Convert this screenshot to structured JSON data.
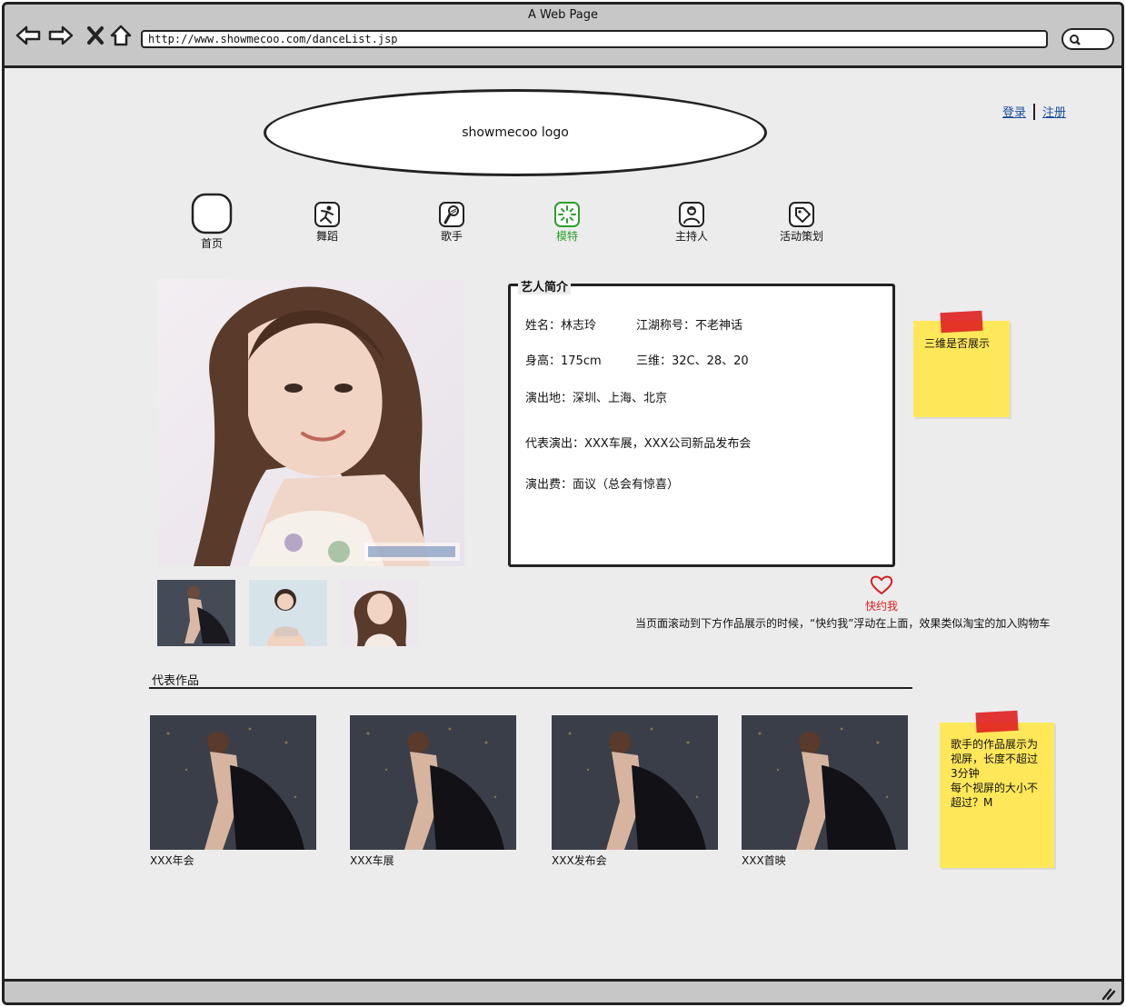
{
  "window": {
    "title": "A Web Page",
    "url": "http://www.showmecoo.com/danceList.jsp"
  },
  "header": {
    "logo_text": "showmecoo logo",
    "login": "登录",
    "register": "注册"
  },
  "nav": [
    {
      "label": "首页",
      "icon": "blank-tile-icon",
      "active": false
    },
    {
      "label": "舞蹈",
      "icon": "dancer-icon",
      "active": false
    },
    {
      "label": "歌手",
      "icon": "microphone-icon",
      "active": false
    },
    {
      "label": "模特",
      "icon": "loading-spinner-icon",
      "active": true
    },
    {
      "label": "主持人",
      "icon": "host-person-icon",
      "active": false
    },
    {
      "label": "活动策划",
      "icon": "tag-icon",
      "active": false
    }
  ],
  "profile": {
    "title": "艺人简介",
    "name": "姓名：林志玲",
    "nickname": "江湖称号：不老神话",
    "height": "身高：175cm",
    "measurements": "三维：32C、28、20",
    "locations": "演出地：深圳、上海、北京",
    "shows": "代表演出：XXX车展，XXX公司新品发布会",
    "fee": "演出费：面议（总会有惊喜）"
  },
  "notes": {
    "note1": "三维是否展示",
    "note2_lines": [
      "歌手的作品展示为",
      "视屏，长度不超过",
      "3分钟",
      "每个视屏的大小不",
      "超过？M"
    ]
  },
  "quick_book": {
    "label": "快约我",
    "description": "当页面滚动到下方作品展示的时候，“快约我”浮动在上面，效果类似淘宝的加入购物车"
  },
  "works": {
    "title": "代表作品",
    "items": [
      {
        "caption": "XXX年会"
      },
      {
        "caption": "XXX车展"
      },
      {
        "caption": "XXX发布会"
      },
      {
        "caption": "XXX首映"
      }
    ]
  },
  "colors": {
    "accent_active": "#2aa02a",
    "link": "#1a4fa0",
    "heart": "#d61f1f",
    "note": "#ffe75a"
  }
}
